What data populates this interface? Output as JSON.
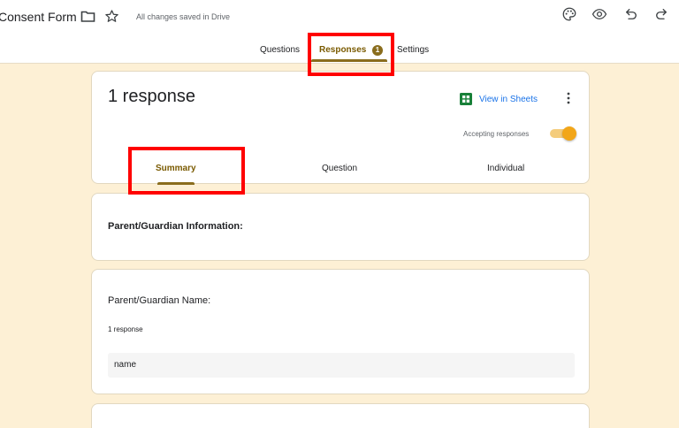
{
  "header": {
    "form_title": "Consent Form",
    "save_status": "All changes saved in Drive",
    "icons": [
      "folder-icon",
      "star-icon",
      "palette-icon",
      "eye-icon",
      "undo-icon",
      "redo-icon"
    ]
  },
  "tabs": {
    "questions": "Questions",
    "responses": "Responses",
    "responses_badge": "1",
    "settings": "Settings",
    "active": "Responses"
  },
  "summary_card": {
    "response_count": "1 response",
    "view_in_sheets": "View in Sheets",
    "accepting_label": "Accepting responses",
    "accepting_on": true,
    "sub_tabs": {
      "summary": "Summary",
      "question": "Question",
      "individual": "Individual",
      "active": "Summary"
    }
  },
  "sections": [
    {
      "title": "Parent/Guardian Information:"
    }
  ],
  "questions": [
    {
      "title": "Parent/Guardian Name:",
      "count": "1 response",
      "answers": [
        "name"
      ]
    }
  ],
  "colors": {
    "page_bg": "#fdf0d5",
    "accent": "#8a6d1d",
    "highlight": "#ff0000",
    "link": "#1a73e8",
    "toggle": "#f2a619"
  }
}
